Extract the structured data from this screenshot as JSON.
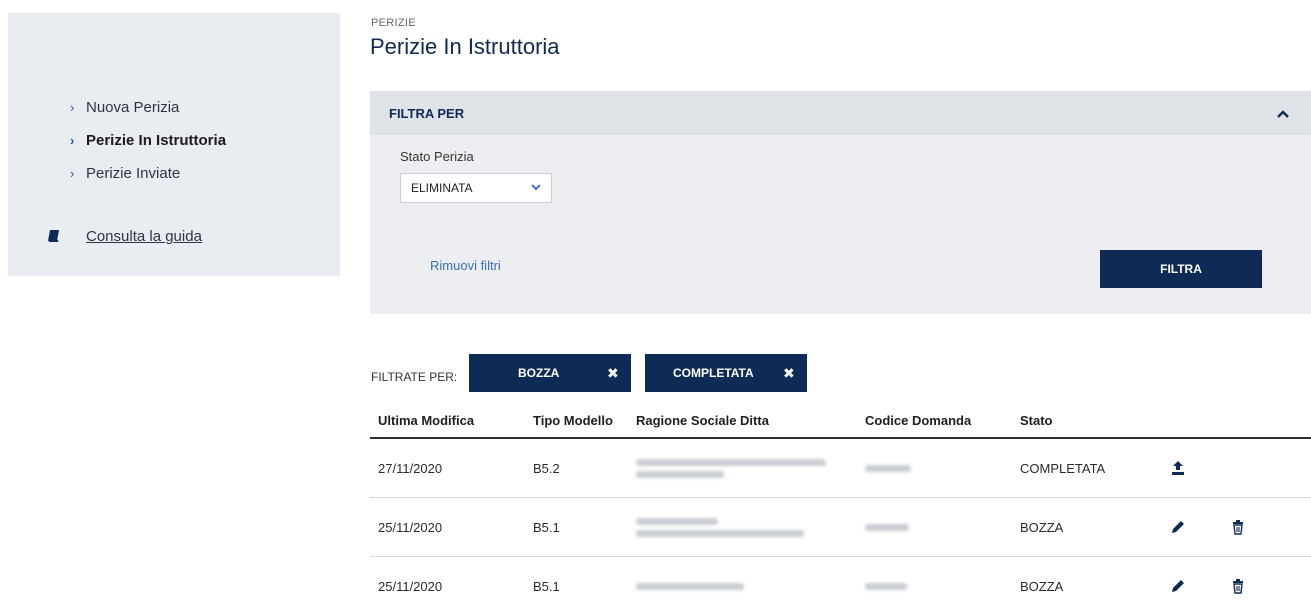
{
  "sidebar": {
    "items": [
      {
        "label": "Nuova Perizia"
      },
      {
        "label": "Perizie In Istruttoria"
      },
      {
        "label": "Perizie Inviate"
      }
    ],
    "guide_label": "Consulta la guida",
    "chevron": "›"
  },
  "breadcrumb": "PERIZIE",
  "page_title": "Perizie In Istruttoria",
  "filter": {
    "header": "FILTRA PER",
    "collapse_icon": "^",
    "field_label": "Stato Perizia",
    "selected_value": "ELIMINATA",
    "dropdown_icon": "⌄",
    "reset_label": "Rimuovi filtri",
    "apply_label": "FILTRA"
  },
  "active_filters": {
    "label": "FILTRATE PER:",
    "chips": [
      {
        "label": "BOZZA",
        "remove_icon": "✖"
      },
      {
        "label": "COMPLETATA",
        "remove_icon": "✖"
      }
    ]
  },
  "table": {
    "columns": [
      "Ultima Modifica",
      "Tipo Modello",
      "Ragione Sociale Ditta",
      "Codice Domanda",
      "Stato"
    ],
    "rows": [
      {
        "date": "27/11/2020",
        "model": "B5.2",
        "status": "COMPLETATA",
        "actions": [
          "upload-icon"
        ]
      },
      {
        "date": "25/11/2020",
        "model": "B5.1",
        "status": "BOZZA",
        "actions": [
          "edit-icon",
          "trash-icon"
        ]
      },
      {
        "date": "25/11/2020",
        "model": "B5.1",
        "status": "BOZZA",
        "actions": [
          "edit-icon",
          "trash-icon"
        ]
      }
    ]
  },
  "colors": {
    "primary": "#0f2b55",
    "sidebar_bg": "#e9ecf1",
    "panel_bg": "#eceef1",
    "link": "#3a6db5"
  }
}
